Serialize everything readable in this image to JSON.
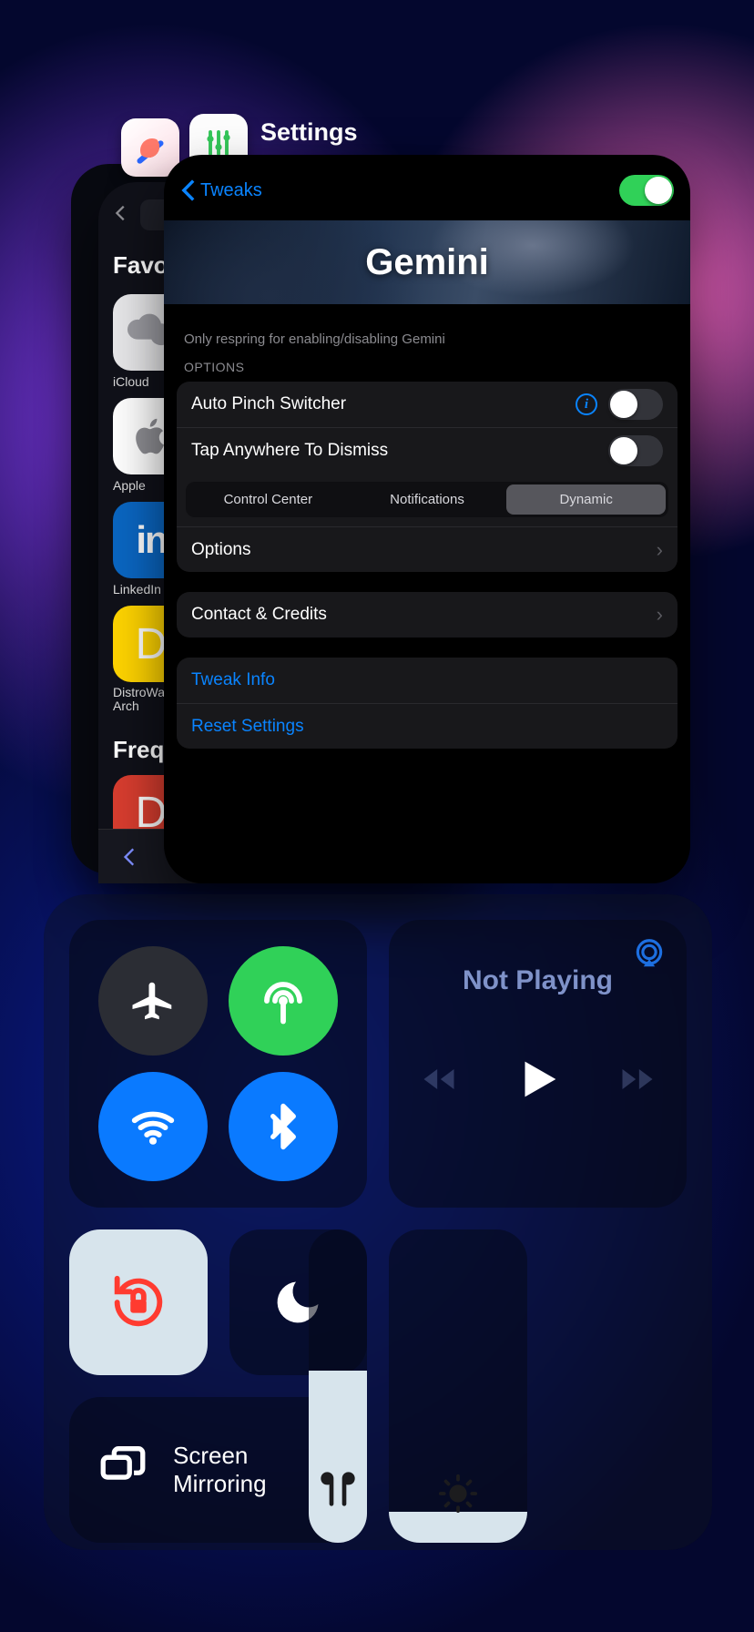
{
  "switcher": {
    "front": {
      "app_name": "Settings",
      "back_label": "Tweaks",
      "master_toggle_on": true,
      "banner_title": "Gemini",
      "note": "Only respring for enabling/disabling Gemini",
      "options_header": "OPTIONS",
      "rows": {
        "auto_pinch": "Auto Pinch Switcher",
        "tap_dismiss": "Tap Anywhere To Dismiss",
        "options": "Options",
        "contact": "Contact & Credits",
        "tweak_info": "Tweak Info",
        "reset": "Reset Settings"
      },
      "segments": [
        "Control Center",
        "Notifications",
        "Dynamic"
      ],
      "segment_selected": 2,
      "auto_pinch_on": false,
      "tap_dismiss_on": false
    },
    "mid": {
      "section1": "Favorites",
      "section2": "Frequently",
      "tiles": [
        {
          "label": "iCloud"
        },
        {
          "label": "Apple"
        },
        {
          "label": "LinkedIn"
        },
        {
          "label": "DistroWatch.com: Arch"
        }
      ]
    }
  },
  "control_center": {
    "media_title": "Not Playing",
    "mirror_label": "Screen Mirroring",
    "airplane_on": false,
    "cellular_on": true,
    "wifi_on": true,
    "bluetooth_on": true,
    "orientation_lock_on": true,
    "dnd_on": false,
    "brightness_pct": 10,
    "volume_pct": 55
  }
}
